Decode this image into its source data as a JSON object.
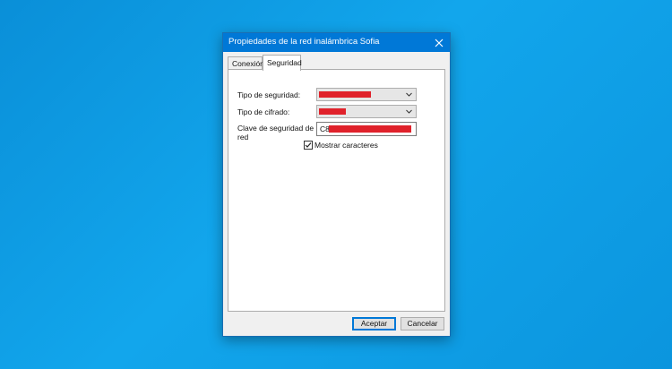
{
  "dialog": {
    "title": "Propiedades de la red inalámbrica Sofia",
    "close_icon": "close-icon"
  },
  "tabs": [
    {
      "label": "Conexión",
      "selected": false
    },
    {
      "label": "Seguridad",
      "selected": true
    }
  ],
  "security": {
    "tipo_seguridad_label": "Tipo de seguridad:",
    "tipo_cifrado_label": "Tipo de cifrado:",
    "clave_label": "Clave de seguridad de red",
    "clave_value": "C8",
    "mostrar_label": "Mostrar caracteres",
    "mostrar_checked": true,
    "redaction_color": "#e0222b"
  },
  "buttons": {
    "aceptar": "Aceptar",
    "cancelar": "Cancelar"
  },
  "colors": {
    "accent": "#0078d7",
    "desktop": "#0a8fd8"
  }
}
